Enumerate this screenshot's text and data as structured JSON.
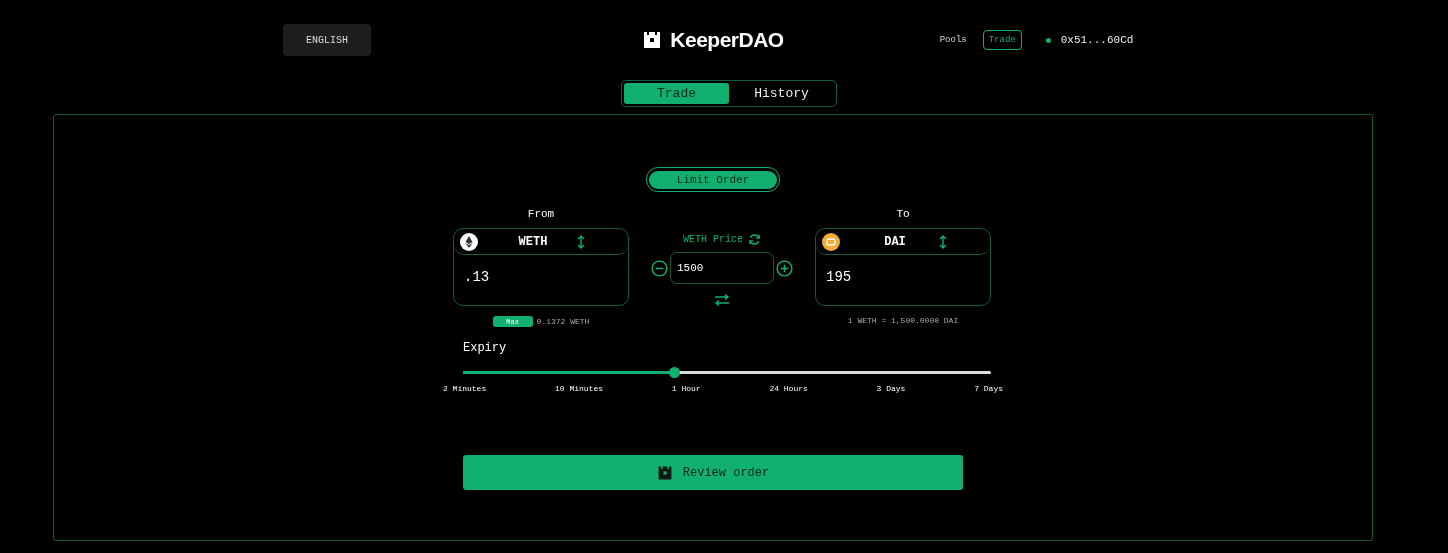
{
  "language_button": "ENGLISH",
  "logo": "KeeperDAO",
  "nav": [
    {
      "label": "Pools",
      "selected": false
    },
    {
      "label": "Trade",
      "selected": true
    }
  ],
  "wallet": {
    "address": "0x51...60Cd"
  },
  "tabs": [
    {
      "label": "Trade",
      "selected": true
    },
    {
      "label": "History",
      "selected": false
    }
  ],
  "order_type": {
    "label": "Limit Order",
    "selected": true
  },
  "from": {
    "label": "From",
    "token": "WETH",
    "amount": ".13",
    "max_label": "Max",
    "balance": "0.1372 WETH"
  },
  "price": {
    "label": "WETH Price",
    "value": "1500"
  },
  "to": {
    "label": "To",
    "token": "DAI",
    "amount": "195",
    "rate": "1 WETH = 1,500.0000 DAI"
  },
  "expiry": {
    "label": "Expiry",
    "level": 0.4,
    "options": [
      "2 Minutes",
      "10 Minutes",
      "1 Hour",
      "24 Hours",
      "3 Days",
      "7 Days"
    ]
  },
  "review_button": "Review order"
}
